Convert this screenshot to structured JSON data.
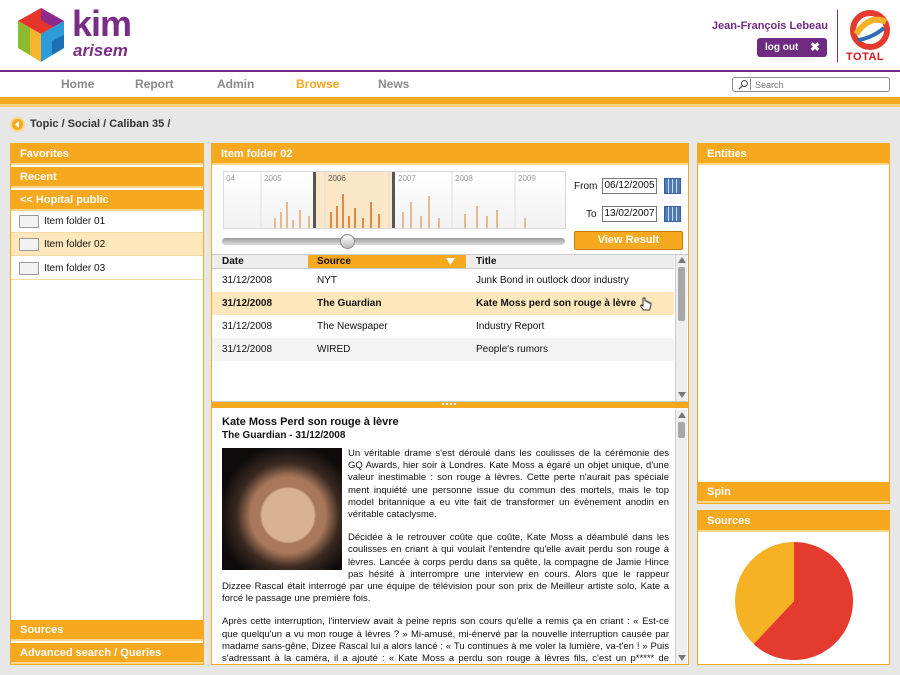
{
  "header": {
    "logo_line1": "kim",
    "logo_line2": "arisem",
    "user_name": "Jean-François Lebeau",
    "logout_label": "log out",
    "brand_text": "TOTAL"
  },
  "nav": {
    "items": [
      "Home",
      "Report",
      "Admin",
      "Browse",
      "News"
    ],
    "active": "Browse",
    "search_placeholder": "Search"
  },
  "breadcrumb": "Topic / Social / Caliban 35 /",
  "left": {
    "favorites": "Favorites",
    "recent": "Recent",
    "group": "<< Hopital public",
    "folders": [
      "Item folder 01",
      "Item folder 02",
      "Item folder 03"
    ],
    "selected_folder": "Item folder 02",
    "sources": "Sources",
    "advanced": "Advanced search / Queries"
  },
  "center": {
    "title": "Item folder 02",
    "timeline_years": [
      "04",
      "2005",
      "2006",
      "2007",
      "2008",
      "2009"
    ],
    "from_label": "From",
    "from_value": "06/12/2005",
    "to_label": "To",
    "to_value": "13/02/2007",
    "view_button": "View Result",
    "columns": [
      "Date",
      "Source",
      "Title"
    ],
    "rows": [
      {
        "date": "31/12/2008",
        "source": "NYT",
        "title": "Junk Bond in outlock door industry"
      },
      {
        "date": "31/12/2008",
        "source": "The Guardian",
        "title": "Kate Moss perd son rouge à lèvre"
      },
      {
        "date": "31/12/2008",
        "source": "The Newspaper",
        "title": "Industry Report"
      },
      {
        "date": "31/12/2008",
        "source": "WIRED",
        "title": "People's rumors"
      }
    ],
    "selected_row": 1,
    "article": {
      "title": "Kate Moss Perd son rouge à lèvre",
      "subtitle": "The Guardian - 31/12/2008",
      "p1": "Un véritable drame s'est déroulé dans les coulisses de la cérémonie des GQ Awards, hier soir à Londres. Kate Moss a égaré un objet unique, d'une valeur inestimable : son rouge à lèvres. Cette perte n'aurait pas spéciale ment inquiété une personne issue du commun des mortels, mais le top model britannique a eu vite fait de transformer un évènement anodin en véritable cataclysme.",
      "p2": "Décidée à le retrouver coûte que coûte, Kate Moss a déambulé dans les coulisses en criant à qui voulait l'entendre qu'elle avait perdu son rouge à lèvres. Lancée à corps perdu dans sa quête, la compagne de Jamie Hince pas hésité à interrompre une interview en cours. Alors que le rappeur Dizzee Rascal était interrogé par une équipe de télévision pour son prix de Meilleur artiste solo, Kate a forcé le passage une première fois.",
      "p3": "Après cette interruption, l'interview avait à peine repris son cours qu'elle a remis ça en criant : « Est-ce que quelqu'un a vu mon rouge à lèvres ? » Mi-amusé, mi-énervé par la nouvelle interruption causée par madame sans-gêne, Dizee Rascal lui a alors lancé : « Tu continues à me voler la lumière, va-t'en ! » Puis s'adressant à la caméra, il a ajouté : « Kate Moss a perdu son rouge à lèvres fils, c'est un p***** de désastre. » Allez savoir, ce tube de rouge à lèvres renfermait peut-être quelque chose de très important pour"
    }
  },
  "right": {
    "entities": "Entities",
    "spin": "Spin",
    "sources": "Sources"
  },
  "chart_data": {
    "type": "pie",
    "labels": [
      "",
      ""
    ],
    "values": [
      62,
      38
    ],
    "colors": [
      "#e53b2f",
      "#f7b124"
    ]
  },
  "colors": {
    "accent": "#f6a81f",
    "brand": "#6f2b82",
    "selection": "#fde7bb"
  }
}
